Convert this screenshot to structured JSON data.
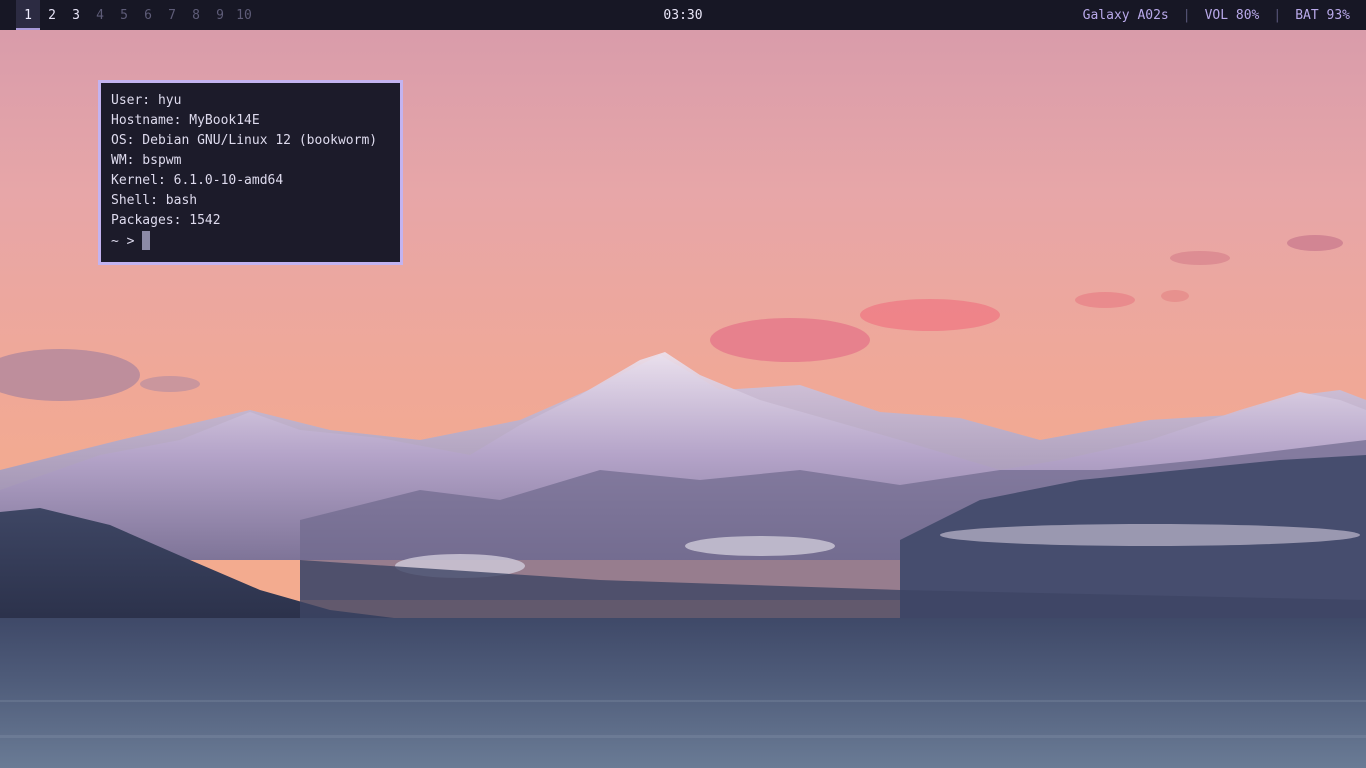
{
  "topbar": {
    "workspaces": [
      {
        "label": "1",
        "state": "active"
      },
      {
        "label": "2",
        "state": "occupied"
      },
      {
        "label": "3",
        "state": "occupied"
      },
      {
        "label": "4",
        "state": "empty"
      },
      {
        "label": "5",
        "state": "empty"
      },
      {
        "label": "6",
        "state": "empty"
      },
      {
        "label": "7",
        "state": "empty"
      },
      {
        "label": "8",
        "state": "empty"
      },
      {
        "label": "9",
        "state": "empty"
      },
      {
        "label": "10",
        "state": "empty"
      }
    ],
    "clock": "03:30",
    "device": "Galaxy A02s",
    "separator": "|",
    "volume": "VOL 80%",
    "battery": "BAT 93%"
  },
  "terminal": {
    "lines": [
      "User: hyu",
      "Hostname: MyBook14E",
      "OS: Debian GNU/Linux 12 (bookworm)",
      "WM: bspwm",
      "Kernel: 6.1.0-10-amd64",
      "Shell: bash",
      "Packages: 1542"
    ],
    "prompt": "~ >"
  },
  "colors": {
    "bar_bg": "#171725",
    "accent": "#c3b3f0",
    "terminal_bg": "#1c1b2a"
  }
}
